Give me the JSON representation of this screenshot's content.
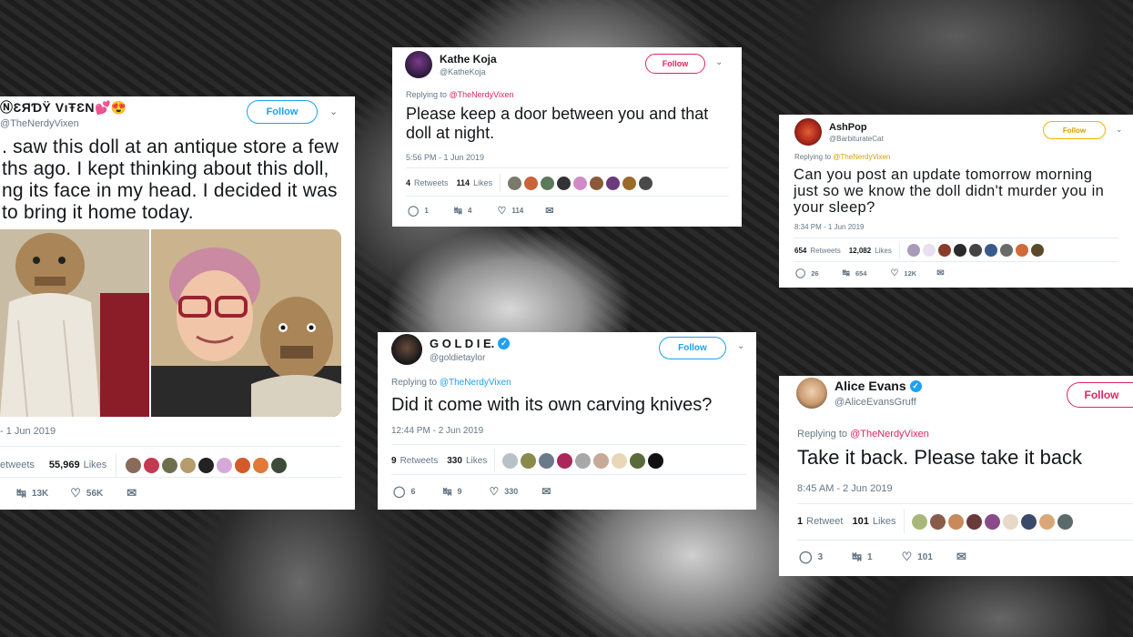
{
  "tweet_main": {
    "name": "ⓃƐЯƊŸ VıŦƐΝ💕😍",
    "handle": "@TheNerdyVixen",
    "follow": "Follow",
    "text": ". saw this doll at an antique store a few\nths ago. I kept thinking about this doll,\nng its face in my head. I decided it was\nto bring it home today.",
    "meta": "- 1 Jun 2019",
    "retweets_label": "etweets",
    "likes_count": "55,969",
    "likes_label": "Likes",
    "retweet_count": "13K",
    "like_count": "56K"
  },
  "tweet_koja": {
    "name": "Kathe Koja",
    "handle": "@KatheKoja",
    "follow": "Follow",
    "replying_prefix": "Replying to ",
    "replying_to": "@TheNerdyVixen",
    "text": "Please keep a door between you and that\ndoll at night.",
    "meta": "5:56 PM - 1 Jun 2019",
    "retweets_count": "4",
    "retweets_label": "Retweets",
    "likes_count": "114",
    "likes_label": "Likes",
    "reply_count": "1",
    "retweet_count": "4",
    "like_count": "114"
  },
  "tweet_ashpop": {
    "name": "AshPop",
    "handle": "@BarbiturateCat",
    "follow": "Follow",
    "replying_prefix": "Replying to ",
    "replying_to": "@TheNerdyVixen",
    "text": "Can you post an update tomorrow morning\njust so we know the doll didn't murder you in\nyour sleep?",
    "meta": "8:34 PM - 1 Jun 2019",
    "retweets_count": "654",
    "retweets_label": "Retweets",
    "likes_count": "12,082",
    "likes_label": "Likes",
    "reply_count": "26",
    "retweet_count": "654",
    "like_count": "12K"
  },
  "tweet_goldie": {
    "name": "G O L D I E.",
    "handle": "@goldietaylor",
    "follow": "Follow",
    "replying_prefix": "Replying to ",
    "replying_to": "@TheNerdyVixen",
    "text": "Did it come with its own carving knives?",
    "meta": "12:44 PM - 2 Jun 2019",
    "retweets_count": "9",
    "retweets_label": "Retweets",
    "likes_count": "330",
    "likes_label": "Likes",
    "reply_count": "6",
    "retweet_count": "9",
    "like_count": "330"
  },
  "tweet_alice": {
    "name": "Alice Evans",
    "handle": "@AliceEvansGruff",
    "follow": "Follow",
    "replying_prefix": "Replying to ",
    "replying_to": "@TheNerdyVixen",
    "text": "Take it back. Please take it back",
    "meta": "8:45 AM - 2 Jun 2019",
    "retweets_count": "1",
    "retweets_label": "Retweet",
    "likes_count": "101",
    "likes_label": "Likes",
    "reply_count": "3",
    "retweet_count": "1",
    "like_count": "101"
  },
  "colors": {
    "like_pink": "#e0245e",
    "twitter_blue": "#1da1f2",
    "gold": "#f4b400",
    "text_dark": "#14171a",
    "text_gray": "#657786"
  },
  "icons": {
    "reply": "reply-icon",
    "retweet": "retweet-icon",
    "like": "heart-icon",
    "dm": "envelope-icon",
    "chevron": "chevron-down-icon",
    "verified": "verified-badge-icon"
  }
}
